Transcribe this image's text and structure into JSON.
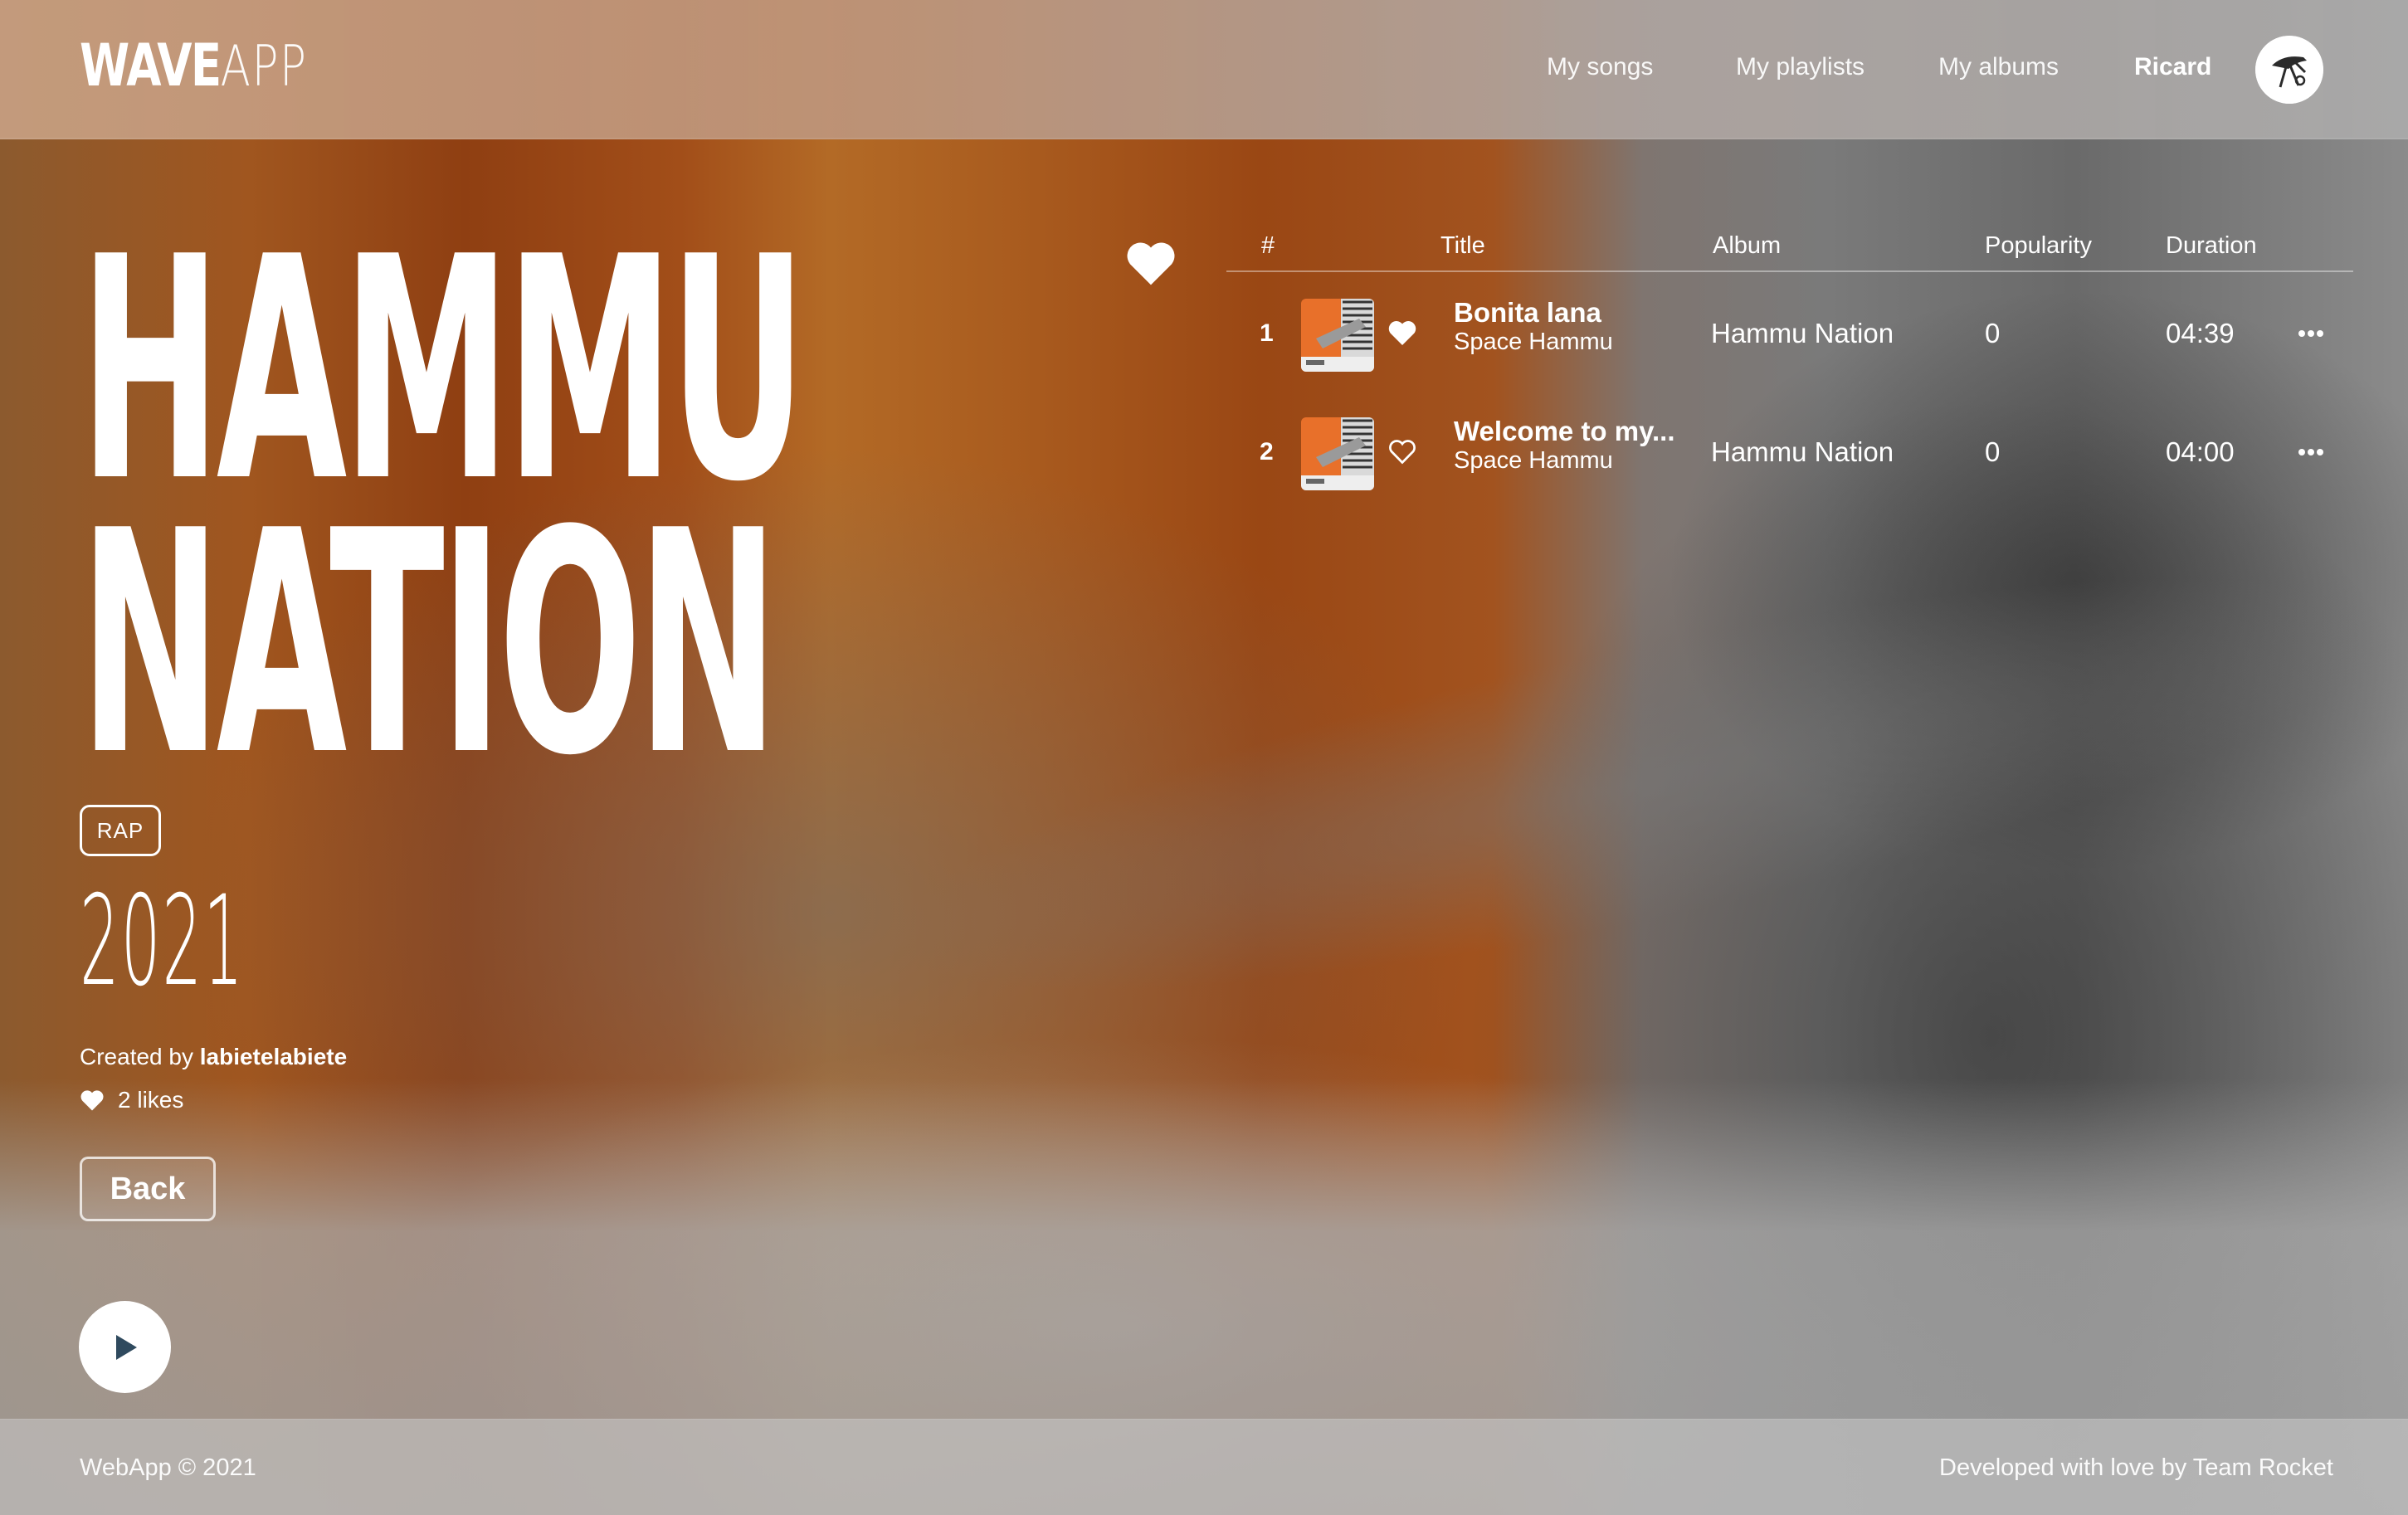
{
  "app": {
    "logo_bold": "WAVE",
    "logo_light": "APP"
  },
  "nav": {
    "items": [
      {
        "label": "My songs"
      },
      {
        "label": "My playlists"
      },
      {
        "label": "My albums"
      }
    ],
    "user_name": "Ricard",
    "avatar_icon": "user-avatar-icon"
  },
  "album": {
    "title_line1": "HAMMU",
    "title_line2": "NATION",
    "genre": "RAP",
    "year": "2021",
    "created_by_label": "Created by",
    "created_by_user": "labietelabiete",
    "likes": "2 likes",
    "favorited": true,
    "back_label": "Back",
    "play_icon": "play-icon"
  },
  "table": {
    "headers": {
      "number": "#",
      "title": "Title",
      "album": "Album",
      "popularity": "Popularity",
      "duration": "Duration"
    },
    "rows": [
      {
        "number": "1",
        "title": "Bonita lana",
        "artist": "Space Hammu",
        "album": "Hammu Nation",
        "popularity": "0",
        "duration": "04:39",
        "liked": true
      },
      {
        "number": "2",
        "title": "Welcome to my...",
        "artist": "Space Hammu",
        "album": "Hammu Nation",
        "popularity": "0",
        "duration": "04:00",
        "liked": false
      }
    ]
  },
  "footer": {
    "left": "WebApp © 2021",
    "right": "Developed with love by Team Rocket"
  },
  "colors": {
    "accent_orange": "#e8702a",
    "play_icon": "#2f4a5e",
    "text": "#ffffff"
  }
}
